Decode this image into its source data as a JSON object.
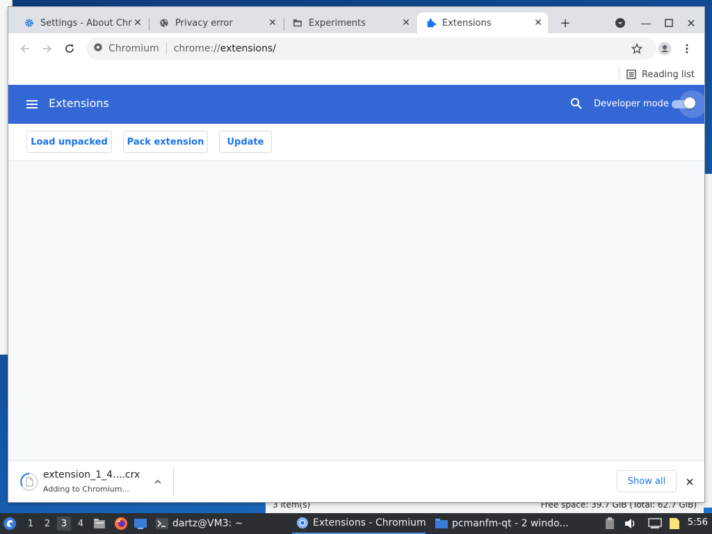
{
  "tabs": [
    {
      "title": "Settings - About Chr",
      "icon": "gear-icon",
      "color": "#1a73e8"
    },
    {
      "title": "Privacy error",
      "icon": "globe-icon"
    },
    {
      "title": "Experiments",
      "icon": "experiments-icon"
    },
    {
      "title": "Extensions",
      "icon": "puzzle-icon",
      "active": true,
      "color": "#1a73e8"
    }
  ],
  "omnibox": {
    "site_label": "Chromium",
    "url_scheme": "chrome://",
    "url_host": "extensions/"
  },
  "bookmarks": {
    "reading_list": "Reading list"
  },
  "extensions_page": {
    "title": "Extensions",
    "developer_mode_label": "Developer mode",
    "developer_mode_on": true,
    "header_color": "#3367d6",
    "buttons": {
      "load_unpacked": "Load unpacked",
      "pack_extension": "Pack extension",
      "update": "Update"
    }
  },
  "download": {
    "filename": "extension_1_4....crx",
    "status": "Adding to Chromium...",
    "show_all": "Show all"
  },
  "taskbar": {
    "workspaces": [
      "1",
      "2",
      "3",
      "4"
    ],
    "active_workspace": "3",
    "tasks": [
      {
        "label": "dartz@VM3: ~",
        "icon": "terminal-icon"
      },
      {
        "label": "Extensions - Chromium",
        "icon": "chromium-icon",
        "active": true
      },
      {
        "label": "pcmanfm-qt - 2 windo...",
        "icon": "folder-icon"
      }
    ],
    "clock": "5:56"
  },
  "background_window": {
    "status_left": "3 item(s)",
    "status_right": "Free space: 39.7 GiB (Total: 62.7 GiB)"
  }
}
